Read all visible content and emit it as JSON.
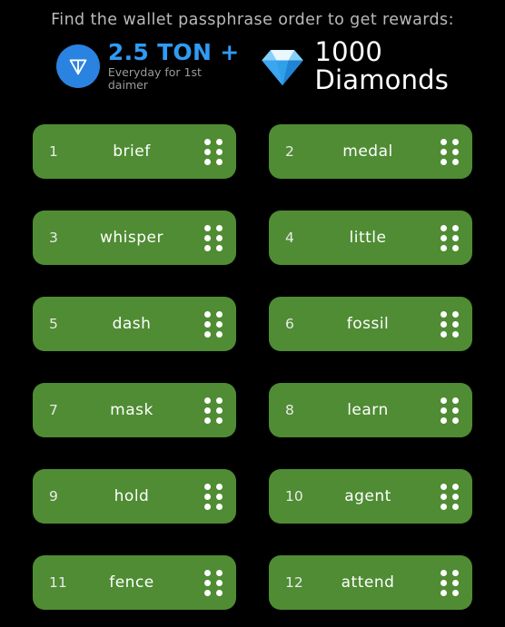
{
  "header": {
    "headline": "Find the wallet passphrase order to get rewards:",
    "rewards": [
      {
        "icon": "ton-logo-icon",
        "amount": "2.5 TON +",
        "subtitle": "Everyday for 1st daimer",
        "accent_color": "#2f9bf5"
      },
      {
        "icon": "diamond-icon",
        "count": "1000",
        "label": "Diamonds",
        "accent_color": "#3aa7f0"
      }
    ]
  },
  "word_grid": {
    "card_color": "#4f8c33",
    "handle_icon": "drag-handle-dots-icon",
    "cards": [
      {
        "index": "1",
        "word": "brief"
      },
      {
        "index": "2",
        "word": "medal"
      },
      {
        "index": "3",
        "word": "whisper"
      },
      {
        "index": "4",
        "word": "little"
      },
      {
        "index": "5",
        "word": "dash"
      },
      {
        "index": "6",
        "word": "fossil"
      },
      {
        "index": "7",
        "word": "mask"
      },
      {
        "index": "8",
        "word": "learn"
      },
      {
        "index": "9",
        "word": "hold"
      },
      {
        "index": "10",
        "word": "agent"
      },
      {
        "index": "11",
        "word": "fence"
      },
      {
        "index": "12",
        "word": "attend"
      }
    ]
  }
}
